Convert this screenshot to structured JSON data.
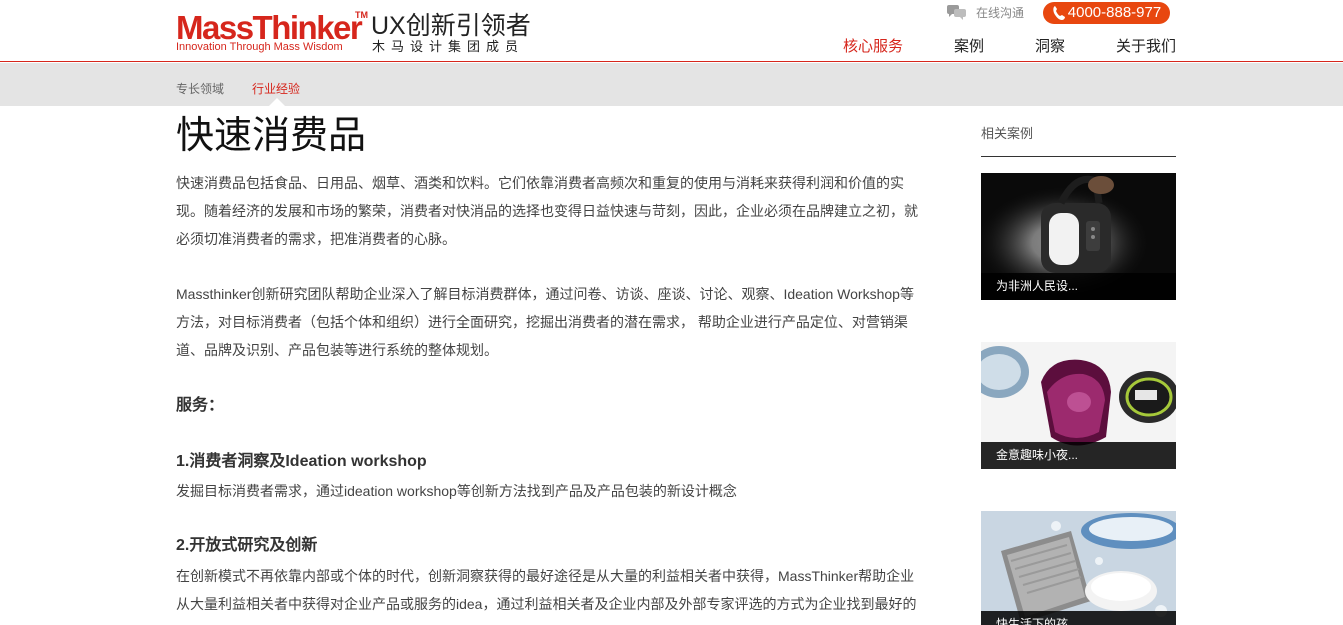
{
  "header": {
    "logo_main": "MassThinker",
    "logo_tm": "TM",
    "logo_sub": "Innovation Through Mass Wisdom",
    "logo_cn": "UX创新引领者",
    "logo_cn_sub": "木马设计集团成员",
    "chat_label": "在线沟通",
    "phone": "4000-888-977",
    "nav": [
      "核心服务",
      "案例",
      "洞察",
      "关于我们"
    ],
    "nav_active": 0
  },
  "subnav": {
    "items": [
      "专长领域",
      "行业经验"
    ],
    "active": 1
  },
  "main": {
    "title": "快速消费品",
    "intro": "快速消费品包括食品、日用品、烟草、酒类和饮料。它们依靠消费者高频次和重复的使用与消耗来获得利润和价值的实现。随着经济的发展和市场的繁荣，消费者对快消品的选择也变得日益快速与苛刻，因此，企业必须在品牌建立之初，就必须切准消费者的需求，把准消费者的心脉。",
    "team": "Massthinker创新研究团队帮助企业深入了解目标消费群体，通过问卷、访谈、座谈、讨论、观察、Ideation Workshop等方法，对目标消费者（包括个体和组织）进行全面研究，挖掘出消费者的潜在需求， 帮助企业进行产品定位、对营销渠道、品牌及识别、产品包装等进行系统的整体规划。",
    "services_heading": "服务：",
    "services": [
      {
        "title": "1.消费者洞察及Ideation workshop",
        "desc": "发掘目标消费者需求，通过ideation workshop等创新方法找到产品及产品包装的新设计概念"
      },
      {
        "title": "2.开放式研究及创新",
        "desc": "在创新模式不再依靠内部或个体的时代，创新洞察获得的最好途径是从大量的利益相关者中获得，MassThinker帮助企业从大量利益相关者中获得对企业产品或服务的idea，通过利益相关者及企业内部及外部专家评选的方式为企业找到最好的"
      }
    ]
  },
  "sidebar": {
    "title": "相关案例",
    "cases": [
      {
        "caption": "为非洲人民设...",
        "icon": "lantern-photo"
      },
      {
        "caption": "金意趣味小夜...",
        "icon": "night-light-photo"
      },
      {
        "caption": "快生活下的孩...",
        "icon": "soap-photo"
      }
    ]
  },
  "colors": {
    "brand_red": "#d6261c",
    "phone_orange": "#e8470f",
    "subnav_bg": "#e4e4e4"
  }
}
